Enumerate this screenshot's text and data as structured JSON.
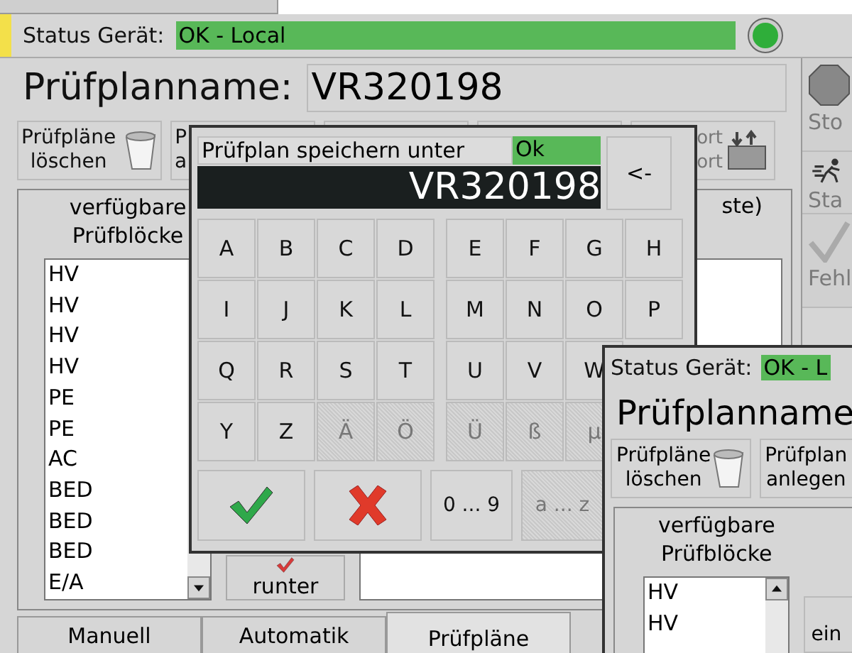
{
  "status": {
    "label": "Status Gerät:",
    "value": "OK - Local",
    "ok": true
  },
  "plan_name": {
    "label": "Prüfplanname:",
    "value": "VR320198"
  },
  "toolbar": [
    {
      "kind": "delete",
      "lines": [
        "Prüfpläne",
        "löschen"
      ]
    },
    {
      "kind": "text",
      "lines": [
        "P",
        "a"
      ]
    },
    {
      "kind": "covered"
    },
    {
      "kind": "covered"
    },
    {
      "kind": "transfer",
      "lines": [
        "ort",
        "ort"
      ]
    }
  ],
  "side_buttons": [
    {
      "kind": "stop",
      "label": "Sto",
      "disabled": true
    },
    {
      "kind": "run",
      "label": "Sta",
      "disabled": true
    },
    {
      "kind": "check",
      "label": "Fehl",
      "disabled": true
    }
  ],
  "group": {
    "title": [
      "verfügbare",
      "Prüfblöcke"
    ],
    "items": [
      "HV",
      "HV",
      "HV",
      "HV",
      "PE",
      "PE",
      "AC",
      "BED",
      "BED",
      "BED",
      "E/A"
    ],
    "move_button": "runter",
    "heading_fragment": "ste)"
  },
  "tabs": [
    {
      "label": "Manuell",
      "selected": false
    },
    {
      "label": "Automatik",
      "selected": false
    },
    {
      "label": "Prüfpläne",
      "selected": true
    }
  ],
  "dialog": {
    "title": "Prüfplan speichern unter",
    "status": "Ok",
    "value": "VR320198",
    "backspace": "<-",
    "keys_left": [
      [
        {
          "label": "A",
          "disabled": false
        },
        {
          "label": "B",
          "disabled": false
        },
        {
          "label": "C",
          "disabled": false
        },
        {
          "label": "D",
          "disabled": false
        }
      ],
      [
        {
          "label": "I",
          "disabled": false
        },
        {
          "label": "J",
          "disabled": false
        },
        {
          "label": "K",
          "disabled": false
        },
        {
          "label": "L",
          "disabled": false
        }
      ],
      [
        {
          "label": "Q",
          "disabled": false
        },
        {
          "label": "R",
          "disabled": false
        },
        {
          "label": "S",
          "disabled": false
        },
        {
          "label": "T",
          "disabled": false
        }
      ],
      [
        {
          "label": "Y",
          "disabled": false
        },
        {
          "label": "Z",
          "disabled": false
        },
        {
          "label": "Ä",
          "disabled": true
        },
        {
          "label": "Ö",
          "disabled": true
        }
      ]
    ],
    "keys_right": [
      [
        {
          "label": "E",
          "disabled": false
        },
        {
          "label": "F",
          "disabled": false
        },
        {
          "label": "G",
          "disabled": false
        },
        {
          "label": "H",
          "disabled": false
        }
      ],
      [
        {
          "label": "M",
          "disabled": false
        },
        {
          "label": "N",
          "disabled": false
        },
        {
          "label": "O",
          "disabled": false
        },
        {
          "label": "P",
          "disabled": false
        }
      ],
      [
        {
          "label": "U",
          "disabled": false
        },
        {
          "label": "V",
          "disabled": false
        },
        {
          "label": "W",
          "disabled": false
        }
      ],
      [
        {
          "label": "Ü",
          "disabled": true
        },
        {
          "label": "ß",
          "disabled": true
        },
        {
          "label": "µ",
          "disabled": true
        }
      ]
    ],
    "digits": {
      "label": "0 ... 9",
      "disabled": false
    },
    "lowercase": {
      "label": "a ... z",
      "disabled": true
    }
  },
  "second_window": {
    "status_label": "Status Gerät:",
    "status_value": "OK - L",
    "plan_label": "Prüfplanname",
    "buttons": [
      {
        "kind": "delete",
        "lines": [
          "Prüfpläne",
          "löschen"
        ]
      },
      {
        "kind": "text",
        "lines": [
          "Prüfplan",
          "anlegen"
        ]
      }
    ],
    "group_title": [
      "verfügbare",
      "Prüfblöcke"
    ],
    "items": [
      "HV",
      "HV"
    ],
    "side_fragment": "ein"
  }
}
